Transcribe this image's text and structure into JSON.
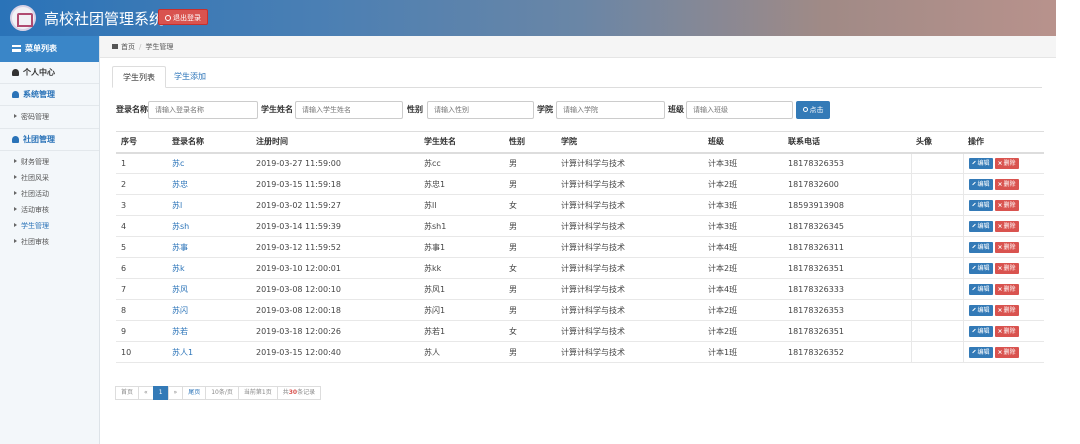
{
  "header": {
    "title": "高校社团管理系统",
    "logout_label": "退出登录"
  },
  "sidebar": {
    "menu_title": "菜单列表",
    "personal": "个人中心",
    "system": {
      "label": "系统管理",
      "items": [
        "密码管理"
      ]
    },
    "club": {
      "label": "社团管理",
      "items": [
        "财务管理",
        "社团风采",
        "社团活动",
        "活动审核",
        "学生管理",
        "社团审核"
      ]
    }
  },
  "breadcrumb": {
    "home": "首页",
    "current": "学生管理"
  },
  "tabs": [
    "学生列表",
    "学生添加"
  ],
  "search": {
    "fields": [
      {
        "label": "登录名称",
        "placeholder": "请输入登录名称"
      },
      {
        "label": "学生姓名",
        "placeholder": "请输入学生姓名"
      },
      {
        "label": "性别",
        "placeholder": "请输入性别"
      },
      {
        "label": "学院",
        "placeholder": "请输入学院"
      },
      {
        "label": "班级",
        "placeholder": "请输入班级"
      }
    ],
    "button_label": "点击"
  },
  "table": {
    "columns": [
      "序号",
      "登录名称",
      "注册时间",
      "学生姓名",
      "性别",
      "学院",
      "班级",
      "联系电话",
      "头像",
      "操作"
    ],
    "rows": [
      [
        "1",
        "苏c",
        "2019-03-27 11:59:00",
        "苏cc",
        "男",
        "计算计科学与技术",
        "计本3班",
        "18178326353",
        ""
      ],
      [
        "2",
        "苏忠",
        "2019-03-15 11:59:18",
        "苏忠1",
        "男",
        "计算计科学与技术",
        "计本2班",
        "1817832600",
        ""
      ],
      [
        "3",
        "苏l",
        "2019-03-02 11:59:27",
        "苏ll",
        "女",
        "计算计科学与技术",
        "计本3班",
        "18593913908",
        ""
      ],
      [
        "4",
        "苏sh",
        "2019-03-14 11:59:39",
        "苏sh1",
        "男",
        "计算计科学与技术",
        "计本3班",
        "18178326345",
        ""
      ],
      [
        "5",
        "苏事",
        "2019-03-12 11:59:52",
        "苏事1",
        "男",
        "计算计科学与技术",
        "计本4班",
        "18178326311",
        ""
      ],
      [
        "6",
        "苏k",
        "2019-03-10 12:00:01",
        "苏kk",
        "女",
        "计算计科学与技术",
        "计本2班",
        "18178326351",
        ""
      ],
      [
        "7",
        "苏风",
        "2019-03-08 12:00:10",
        "苏风1",
        "男",
        "计算计科学与技术",
        "计本4班",
        "18178326333",
        ""
      ],
      [
        "8",
        "苏闪",
        "2019-03-08 12:00:18",
        "苏闪1",
        "男",
        "计算计科学与技术",
        "计本2班",
        "18178326353",
        ""
      ],
      [
        "9",
        "苏若",
        "2019-03-18 12:00:26",
        "苏若1",
        "女",
        "计算计科学与技术",
        "计本2班",
        "18178326351",
        ""
      ],
      [
        "10",
        "苏人1",
        "2019-03-15 12:00:40",
        "苏人",
        "男",
        "计算计科学与技术",
        "计本1班",
        "18178326352",
        ""
      ]
    ],
    "edit_label": "编辑",
    "delete_label": "删除"
  },
  "pagination": {
    "first": "首页",
    "prev": "«",
    "current": "1",
    "next": "»",
    "last": "尾页",
    "per_page": "10条/页",
    "current_page": "当前第1页",
    "total_prefix": "共",
    "total_count": "30",
    "total_suffix": "条记录"
  }
}
